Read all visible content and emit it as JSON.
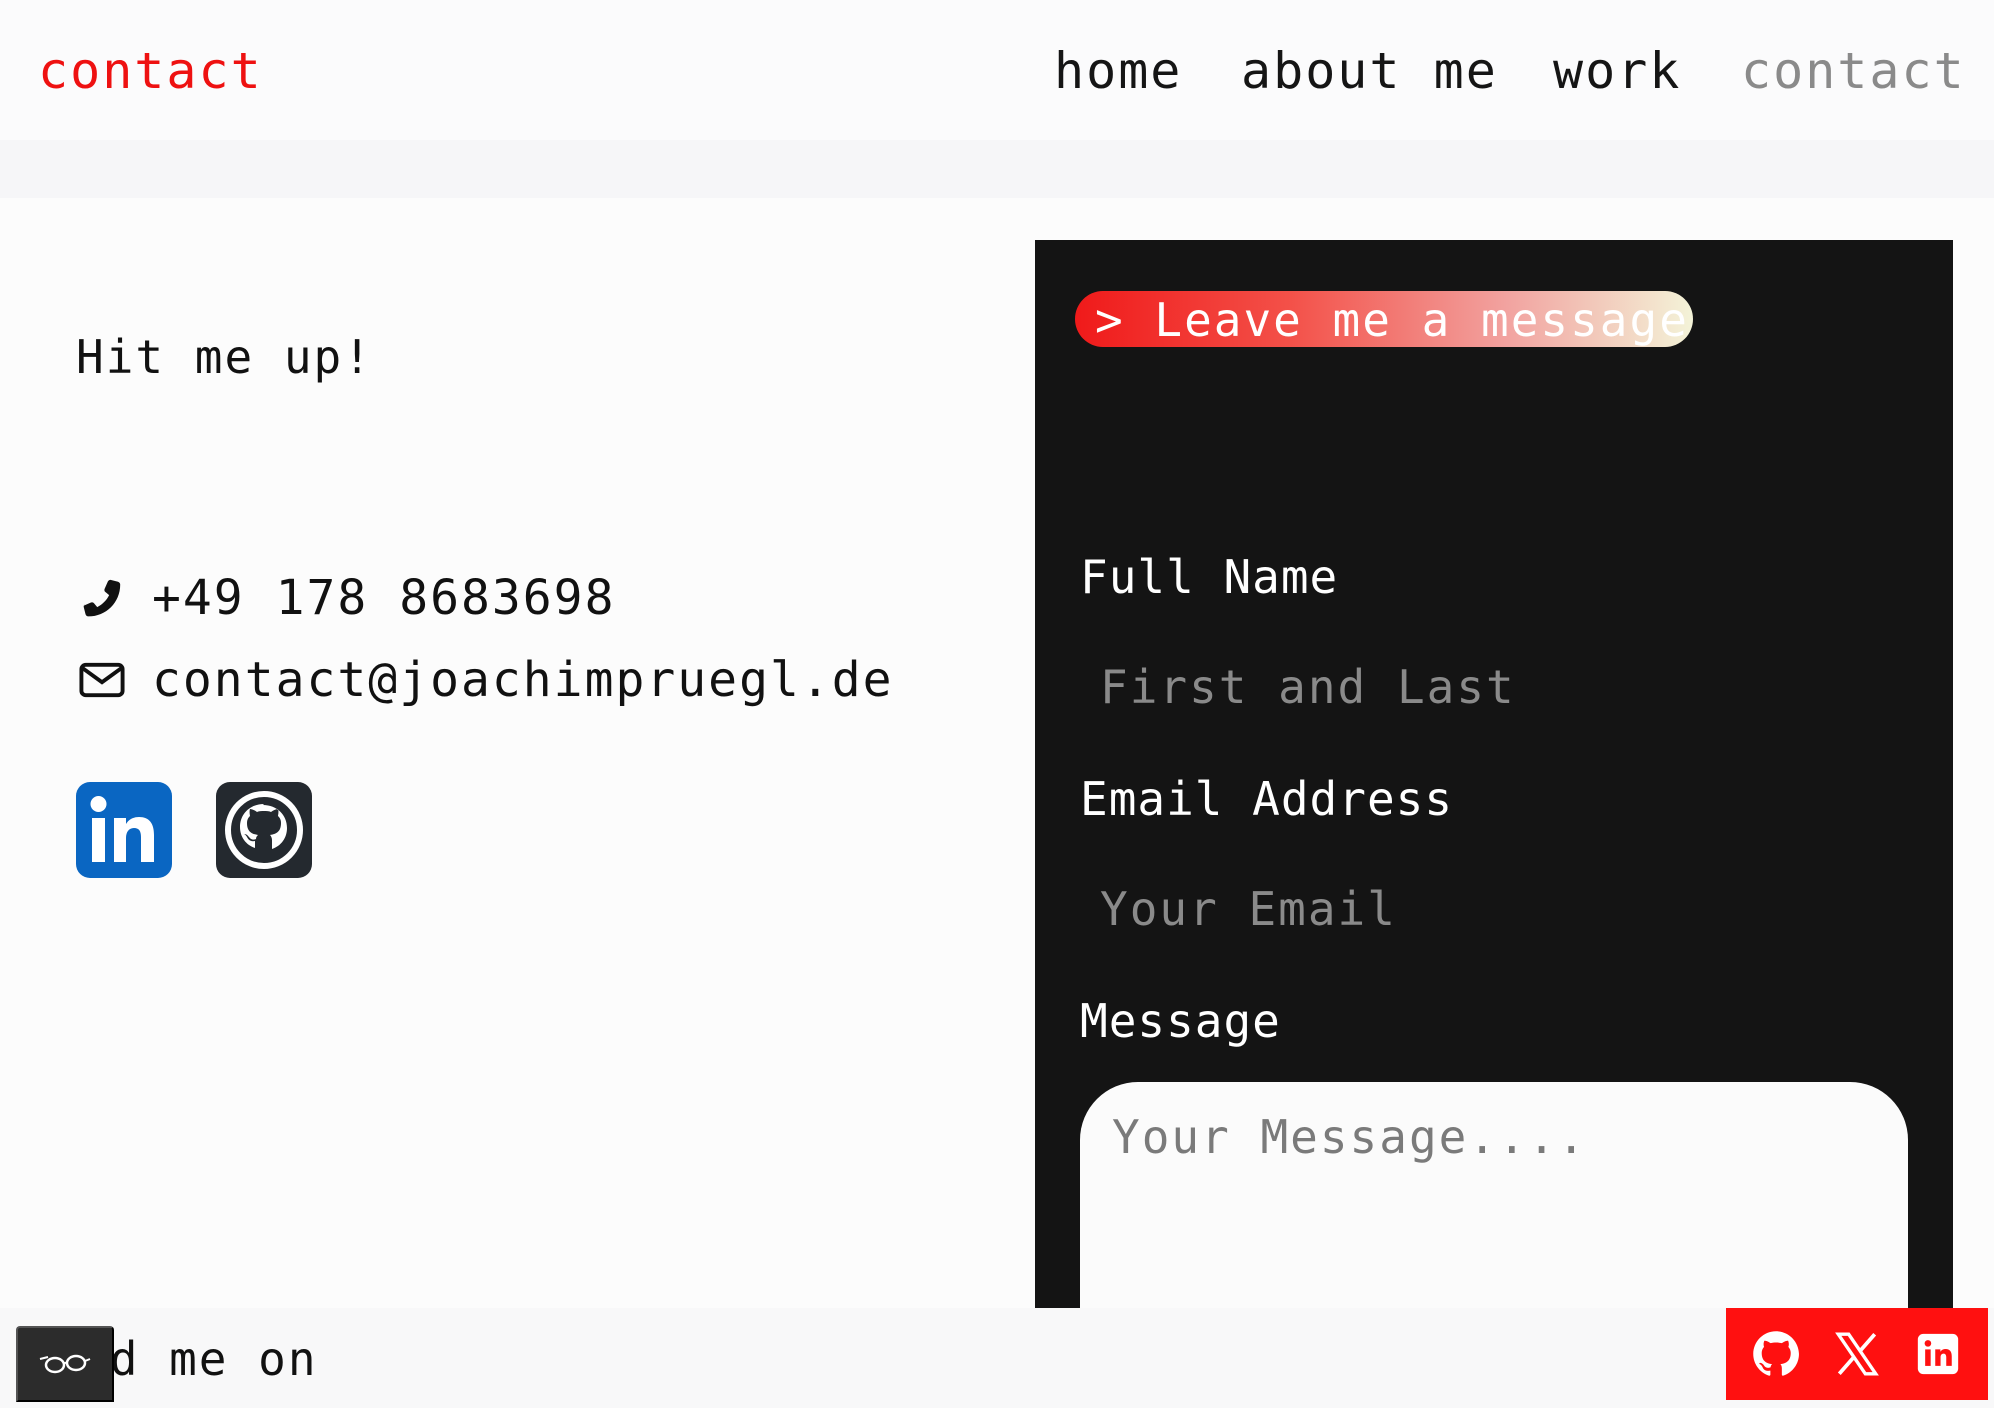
{
  "header": {
    "brand": "contact",
    "nav": [
      {
        "label": "home"
      },
      {
        "label": "about me"
      },
      {
        "label": "work"
      },
      {
        "label": "contact",
        "active": true
      }
    ]
  },
  "contact_info": {
    "greeting": "Hit me up!",
    "phone": "+49 178 8683698",
    "email": "contact@joachimpruegl.de",
    "socials": [
      {
        "icon": "linkedin-icon",
        "color": "#0a66c2"
      },
      {
        "icon": "github-icon",
        "color": "#24292f"
      }
    ]
  },
  "form": {
    "heading": "> Leave me a message",
    "name_label": "Full Name",
    "name_placeholder": "First and Last",
    "email_label": "Email Address",
    "email_placeholder": "Your Email",
    "message_label": "Message",
    "message_placeholder": "Your Message....",
    "panel_color": "#141414"
  },
  "footer": {
    "find_me_text": "nd me on",
    "accessibility_icon": "glasses-icon",
    "social_bar_color": "#ff1010",
    "social_bar_icons": [
      "github-icon",
      "x-icon",
      "linkedin-icon"
    ]
  },
  "colors": {
    "accent": "#ee1111",
    "nav_active": "#8a8a8a"
  }
}
